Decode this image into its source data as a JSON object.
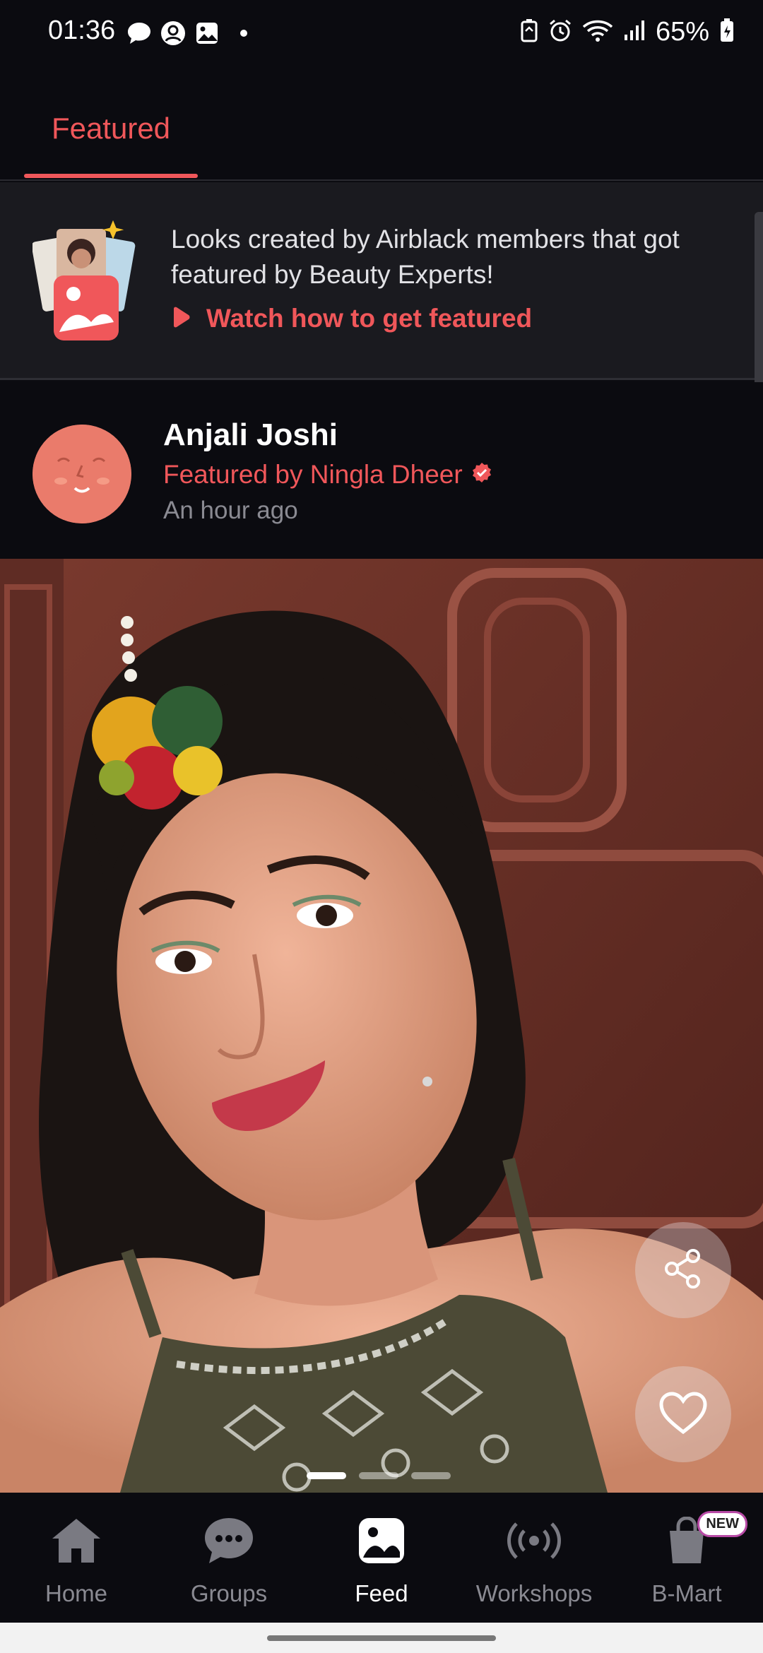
{
  "status_bar": {
    "time": "01:36",
    "battery": "65%",
    "icons": [
      "chat-bubble-icon",
      "account-icon",
      "image-icon",
      "dot-icon",
      "battery-saver-icon",
      "alarm-icon",
      "wifi-icon",
      "signal-icon",
      "battery-icon"
    ]
  },
  "tabs": {
    "featured_label": "Featured"
  },
  "banner": {
    "text": "Looks created by Airblack members that got featured by Beauty Experts!",
    "link_label": "Watch how to get featured"
  },
  "post": {
    "author": "Anjali Joshi",
    "featured_by": "Featured by Ningla Dheer",
    "time_ago": "An hour ago",
    "image_count": 3,
    "current_image": 1
  },
  "bottom_nav": {
    "items": [
      {
        "label": "Home",
        "icon": "home-icon"
      },
      {
        "label": "Groups",
        "icon": "chat-icon"
      },
      {
        "label": "Feed",
        "icon": "image-icon"
      },
      {
        "label": "Workshops",
        "icon": "broadcast-icon"
      },
      {
        "label": "B-Mart",
        "icon": "shopping-bag-icon"
      }
    ],
    "active": "Feed",
    "badge": "NEW"
  },
  "colors": {
    "accent": "#f0575a",
    "background": "#0b0b10",
    "banner_bg": "#1a1a1f"
  }
}
